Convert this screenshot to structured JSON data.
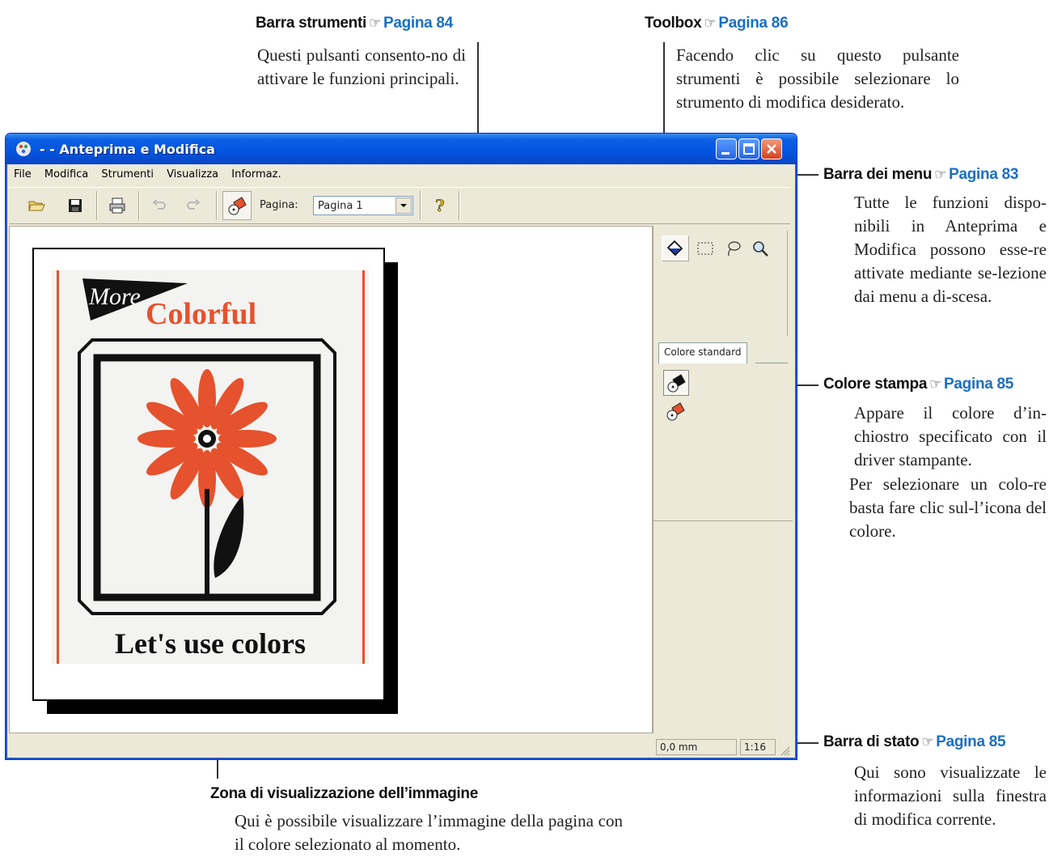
{
  "callouts": {
    "toolbar": {
      "title": "Barra strumenti",
      "ref": "Pagina 84",
      "text": "Questi pulsanti consento-no di attivare le funzioni principali."
    },
    "toolbox": {
      "title": "Toolbox",
      "ref": "Pagina 86",
      "text": "Facendo clic su questo pulsante strumenti è possibile selezionare lo strumento di modifica desiderato."
    },
    "menubar": {
      "title": "Barra dei menu",
      "ref": "Pagina 83",
      "text": "Tutte le funzioni dispo-nibili in Anteprima e Modifica possono esse-re attivate mediante se-lezione dai menu a di-scesa."
    },
    "printcolor": {
      "title": "Colore stampa",
      "ref": "Pagina 85",
      "text1": "Appare il colore d’in-chiostro specificato con il driver stampante.",
      "text2": "Per selezionare un colo-re basta fare clic sul-l’icona del colore."
    },
    "statusbar": {
      "title": "Barra di stato",
      "ref": "Pagina 85",
      "text": "Qui sono visualizzate le informazioni sulla finestra di modifica corrente."
    },
    "viewarea": {
      "title": "Zona di visualizzazione dell’immagine",
      "text": "Qui è possibile visualizzare l’immagine della pagina con il colore selezionato al momento."
    },
    "hand_glyph": "☞"
  },
  "window": {
    "title": "- - Anteprima e Modifica",
    "menu": [
      "File",
      "Modifica",
      "Strumenti",
      "Visualizza",
      "Informaz."
    ],
    "toolbar": {
      "page_label": "Pagina:",
      "page_value": "Pagina  1"
    },
    "sidebar": {
      "tab_label": "Colore standard"
    },
    "status": {
      "position": "0,0 mm",
      "zoom": "1:16"
    }
  },
  "poster": {
    "more": "More",
    "colorful": "Colorful",
    "slogan": "Let's use colors"
  },
  "colors": {
    "accent_ref": "#1a6fc4",
    "poster_red": "#e5522d",
    "title_blue": "#0554e0"
  }
}
